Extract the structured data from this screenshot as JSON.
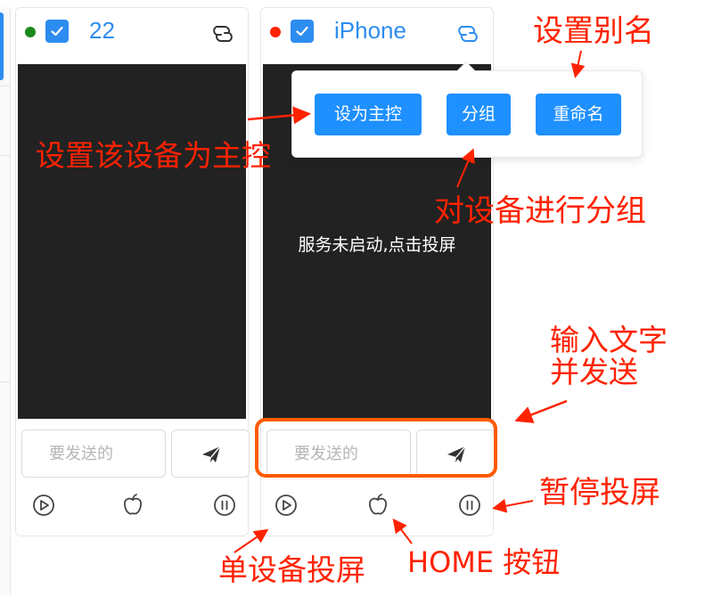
{
  "devices": [
    {
      "name": "22",
      "status_color": "#1a8a1a",
      "checked": true,
      "input_placeholder": "要发送的",
      "icons": {
        "link": "link-icon",
        "send": "send-icon",
        "play": "play-icon",
        "home": "apple-icon",
        "pause": "pause-icon"
      }
    },
    {
      "name": "iPhone",
      "status_color": "#ff2200",
      "checked": true,
      "screen_message": "服务未启动,点击投屏",
      "input_placeholder": "要发送的",
      "icons": {
        "link": "link-icon",
        "send": "send-icon",
        "play": "play-icon",
        "home": "apple-icon",
        "pause": "pause-icon"
      }
    }
  ],
  "popover": {
    "buttons": [
      {
        "label": "设为主控"
      },
      {
        "label": "分组"
      },
      {
        "label": "重命名"
      }
    ]
  },
  "annotations": {
    "set_alias": "设置别名",
    "set_master": "设置该设备为主控",
    "group_device": "对设备进行分组",
    "input_send_line1": "输入文字",
    "input_send_line2": "并发送",
    "pause_cast": "暂停投屏",
    "single_cast": "单设备投屏",
    "home_button": "HOME 按钮"
  },
  "colors": {
    "accent": "#2d8cf0",
    "popover_button": "#1e90ff",
    "annotation": "#ff2200",
    "highlight": "#ff5a00",
    "screen_bg": "#222222"
  }
}
